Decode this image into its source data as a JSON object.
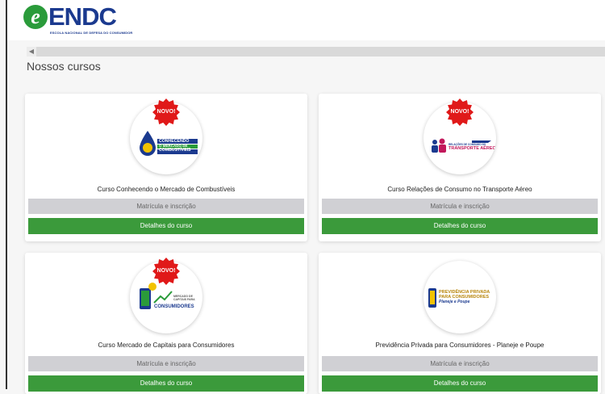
{
  "header": {
    "logo_letter": "e",
    "logo_word": "ENDC",
    "logo_tagline": "ESCOLA NACIONAL DE DEFESA DO CONSUMIDOR"
  },
  "section": {
    "title": "Nossos cursos"
  },
  "courses": [
    {
      "badge": "NOVO!",
      "thumb_lines": [
        "CONHECENDO",
        "O MERCADO DE",
        "COMBUSTÍVEIS"
      ],
      "title": "Curso Conhecendo o Mercado de Combustíveis",
      "enroll_label": "Matrícula e inscrição",
      "details_label": "Detalhes do curso"
    },
    {
      "badge": "NOVO!",
      "thumb_lines": [
        "RELAÇÕES DE CONSUMO NO",
        "TRANSPORTE AÉREO"
      ],
      "title": "Curso Relações de Consumo no Transporte Aéreo",
      "enroll_label": "Matrícula e inscrição",
      "details_label": "Detalhes do curso"
    },
    {
      "badge": "NOVO!",
      "thumb_lines": [
        "MERCADO DE",
        "CAPITAIS PARA",
        "CONSUMIDORES"
      ],
      "title": "Curso Mercado de Capitais para Consumidores",
      "enroll_label": "Matrícula e inscrição",
      "details_label": "Detalhes do curso"
    },
    {
      "thumb_lines": [
        "PREVIDÊNCIA PRIVADA",
        "PARA CONSUMIDORES",
        "Planeje e Poupe"
      ],
      "title": "Previdência Privada para Consumidores - Planeje e Poupe",
      "enroll_label": "Matrícula e inscrição",
      "details_label": "Detalhes do curso"
    }
  ],
  "colors": {
    "brand_blue": "#1b3a8f",
    "brand_green": "#2a9b3a",
    "details_button": "#3b9a3b",
    "enroll_button": "#d0d0d4",
    "badge_red": "#e01919"
  }
}
